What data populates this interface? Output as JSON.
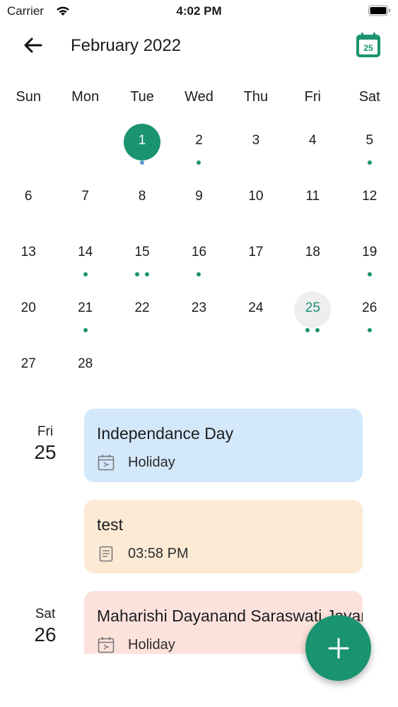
{
  "status_bar": {
    "carrier": "Carrier",
    "time": "4:02 PM"
  },
  "header": {
    "title": "February 2022",
    "today_icon_label": "25"
  },
  "weekdays": [
    "Sun",
    "Mon",
    "Tue",
    "Wed",
    "Thu",
    "Fri",
    "Sat"
  ],
  "calendar": {
    "selected_day": "1",
    "today_day": "25",
    "weeks": [
      [
        {
          "n": ""
        },
        {
          "n": ""
        },
        {
          "n": "1",
          "dots": 1,
          "dot_color": "#5b9bd5"
        },
        {
          "n": "2",
          "dots": 1
        },
        {
          "n": "3"
        },
        {
          "n": "4"
        },
        {
          "n": "5",
          "dots": 1
        }
      ],
      [
        {
          "n": "6"
        },
        {
          "n": "7"
        },
        {
          "n": "8"
        },
        {
          "n": "9"
        },
        {
          "n": "10"
        },
        {
          "n": "11"
        },
        {
          "n": "12"
        }
      ],
      [
        {
          "n": "13"
        },
        {
          "n": "14",
          "dots": 1
        },
        {
          "n": "15",
          "dots": 2
        },
        {
          "n": "16",
          "dots": 1
        },
        {
          "n": "17"
        },
        {
          "n": "18"
        },
        {
          "n": "19",
          "dots": 1
        }
      ],
      [
        {
          "n": "20"
        },
        {
          "n": "21",
          "dots": 1
        },
        {
          "n": "22"
        },
        {
          "n": "23"
        },
        {
          "n": "24"
        },
        {
          "n": "25",
          "dots": 2
        },
        {
          "n": "26",
          "dots": 1
        }
      ],
      [
        {
          "n": "27"
        },
        {
          "n": "28"
        },
        {
          "n": ""
        },
        {
          "n": ""
        },
        {
          "n": ""
        },
        {
          "n": ""
        },
        {
          "n": ""
        }
      ]
    ]
  },
  "agenda": {
    "groups": [
      {
        "weekday": "Fri",
        "day": "25"
      },
      {
        "weekday": "Sat",
        "day": "26"
      }
    ],
    "events": [
      {
        "title": "Independance Day",
        "meta": "Holiday",
        "icon": "holiday-calendar-icon",
        "color": "#d3e8fb"
      },
      {
        "title": "test",
        "meta": "03:58 PM",
        "icon": "reminder-note-icon",
        "color": "#fcead5"
      },
      {
        "title": "Maharishi Dayanand Saraswati Jayanti",
        "meta": "Holiday",
        "icon": "holiday-calendar-icon",
        "color": "#fde2dc"
      }
    ]
  },
  "colors": {
    "accent": "#1a9370",
    "dot_blue": "#5b9bd5"
  },
  "fab": {
    "icon": "plus-icon"
  }
}
